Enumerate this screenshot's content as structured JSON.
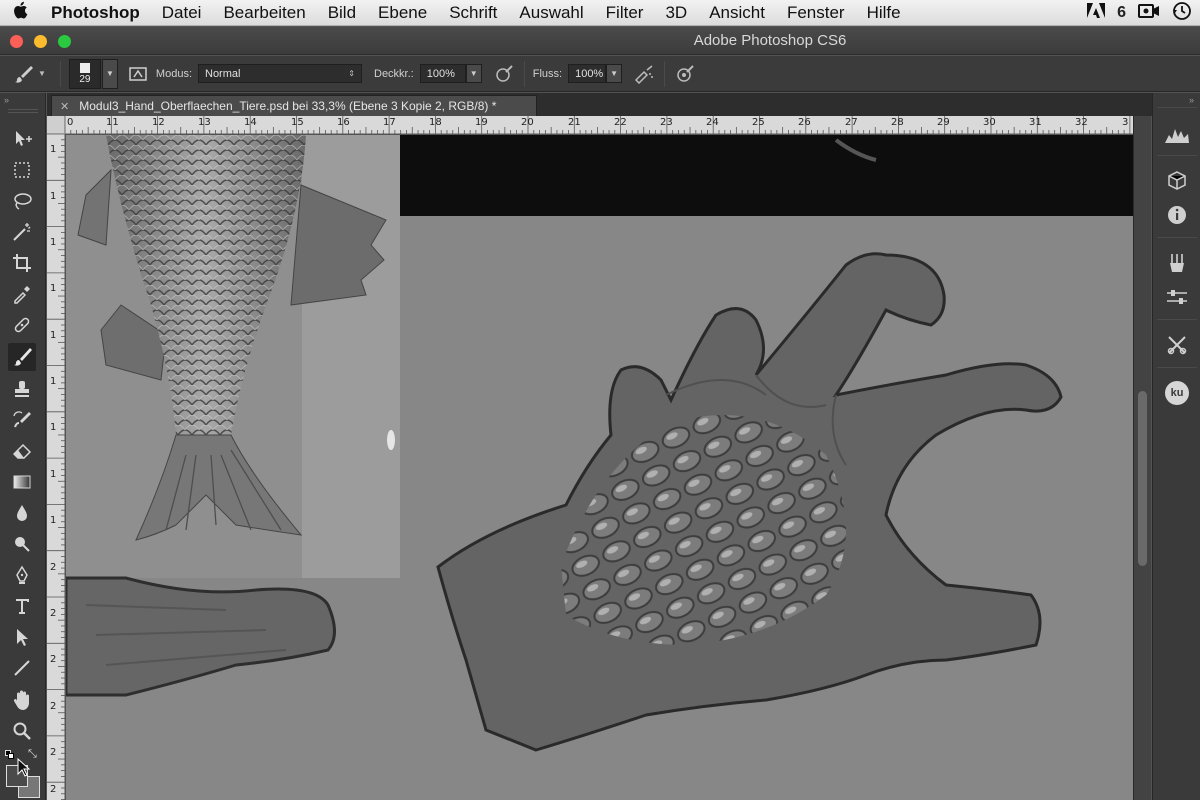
{
  "menubar": {
    "app_name": "Photoshop",
    "items": [
      "Datei",
      "Bearbeiten",
      "Bild",
      "Ebene",
      "Schrift",
      "Auswahl",
      "Filter",
      "3D",
      "Ansicht",
      "Fenster",
      "Hilfe"
    ]
  },
  "window": {
    "title": "Adobe Photoshop CS6"
  },
  "options_bar": {
    "brush_size": "29",
    "mode_label": "Modus:",
    "mode_value": "Normal",
    "opacity_label": "Deckkr.:",
    "opacity_value": "100%",
    "flow_label": "Fluss:",
    "flow_value": "100%"
  },
  "document": {
    "tab_title": "Modul3_Hand_Oberflaechen_Tiere.psd bei 33,3% (Ebene 3 Kopie 2, RGB/8) *"
  },
  "rulers": {
    "horizontal": [
      "0",
      "11",
      "12",
      "13",
      "14",
      "15",
      "16",
      "17",
      "18",
      "19",
      "20",
      "21",
      "22",
      "23",
      "24",
      "25",
      "26",
      "27",
      "28",
      "29",
      "30",
      "31",
      "32",
      "3"
    ],
    "vertical": [
      "1",
      "1",
      "1",
      "1",
      "1",
      "1",
      "1",
      "1",
      "1",
      "2",
      "2",
      "2",
      "2",
      "2",
      "2"
    ]
  },
  "dock": {
    "ku_label": "ku"
  },
  "colors": {
    "chrome_dark": "#3a3a3a",
    "canvas_gray": "#878787",
    "ruler": "#d9d9d9"
  }
}
